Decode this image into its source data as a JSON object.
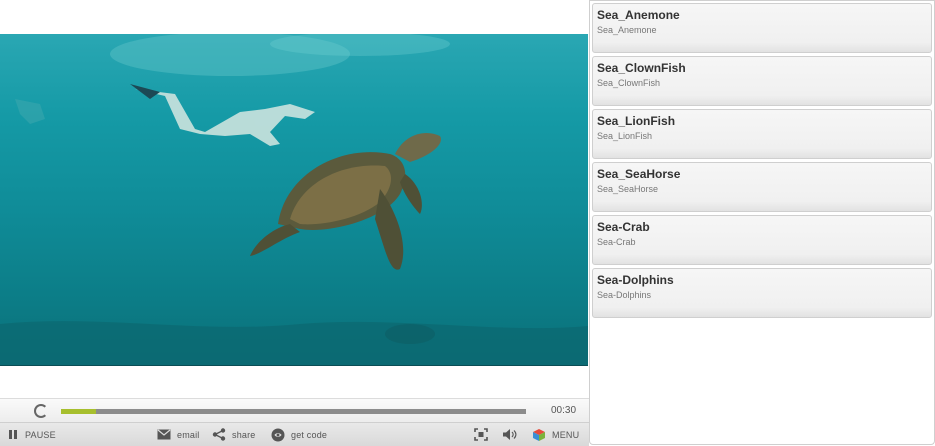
{
  "player": {
    "time": "00:30",
    "progress_fraction": 0.075,
    "controls": {
      "pause_label": "PAUSE",
      "email_label": "email",
      "share_label": "share",
      "getcode_label": "get code",
      "menu_label": "MENU"
    }
  },
  "playlist": {
    "items": [
      {
        "title": "Sea_Anemone",
        "subtitle": "Sea_Anemone"
      },
      {
        "title": "Sea_ClownFish",
        "subtitle": "Sea_ClownFish"
      },
      {
        "title": "Sea_LionFish",
        "subtitle": "Sea_LionFish"
      },
      {
        "title": "Sea_SeaHorse",
        "subtitle": "Sea_SeaHorse"
      },
      {
        "title": "Sea-Crab",
        "subtitle": "Sea-Crab"
      },
      {
        "title": "Sea-Dolphins",
        "subtitle": "Sea-Dolphins"
      }
    ]
  },
  "colors": {
    "progress_fill": "#a7bf2e",
    "progress_track": "#8c8c8c",
    "water": "#159aa6"
  }
}
